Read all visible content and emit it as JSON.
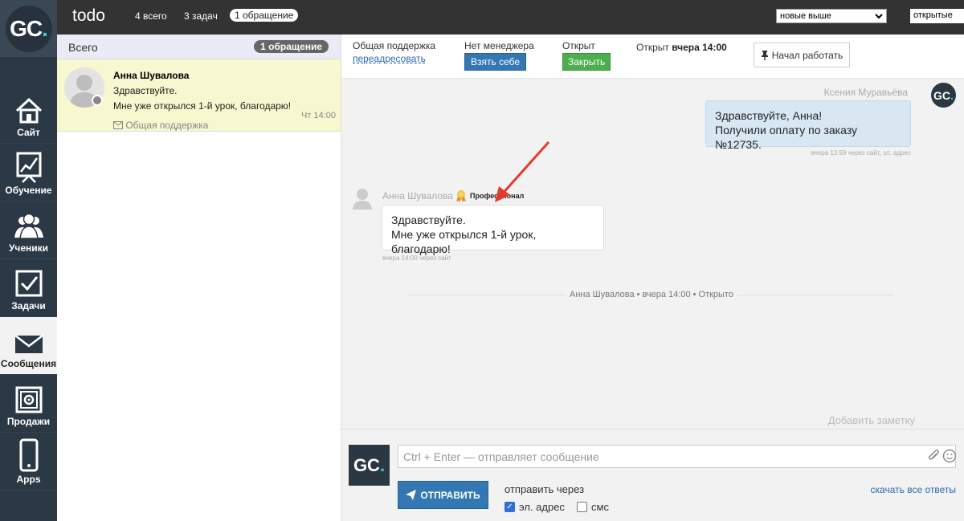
{
  "logo": {
    "text": "GC",
    "dot": "."
  },
  "nav": [
    {
      "label": "Сайт",
      "icon": "house-icon"
    },
    {
      "label": "Обучение",
      "icon": "chart-board-icon"
    },
    {
      "label": "Ученики",
      "icon": "people-icon"
    },
    {
      "label": "Задачи",
      "icon": "checkbox-icon"
    },
    {
      "label": "Сообщения",
      "icon": "envelope-icon"
    },
    {
      "label": "Продажи",
      "icon": "safe-icon"
    },
    {
      "label": "Apps",
      "icon": "phone-icon"
    }
  ],
  "topbar": {
    "title": "todo",
    "total": "4 всего",
    "tasks": "3 задач",
    "requests": "1 обращение",
    "sort": "новые выше",
    "filter": "открытые"
  },
  "list": {
    "header": "Всего",
    "badge": "1 обращение",
    "item": {
      "name": "Анна Шувалова",
      "line1": "Здравствуйте.",
      "line2": "Мне уже открылся 1-й урок, благодарю!",
      "source": "Общая поддержка",
      "time": "Чт 14:00"
    }
  },
  "header": {
    "dept_label": "Общая поддержка",
    "redirect": "переадресовать",
    "manager_label": "Нет менеджера",
    "take": "Взять себе",
    "status_label": "Открыт",
    "close": "Закрыть",
    "opened_prefix": "Открыт",
    "opened_time": "вчера 14:00",
    "start_work": "Начал работать"
  },
  "chat": {
    "operator_name": "Ксения Муравьёва",
    "operator_line1": "Здравствуйте, Анна!",
    "operator_line2": "Получили оплату по заказу №12735.",
    "operator_meta": "вчера 13:59 через сайт, эл. адрес",
    "client_name": "Анна Шувалова",
    "client_rank": "Профессионал",
    "client_line1": "Здравствуйте.",
    "client_line2": "Мне уже открылся 1-й урок, благодарю!",
    "client_meta": "вчера 14:00 через сайт",
    "divider": "Анна Шувалова • вчера 14:00 • Открыто",
    "add_note": "Добавить заметку"
  },
  "composer": {
    "placeholder": "Ctrl + Enter — отправляет сообщение",
    "send": "ОТПРАВИТЬ",
    "send_via": "отправить через",
    "email": "эл. адрес",
    "email_checked": true,
    "sms": "смс",
    "sms_checked": false,
    "download": "скачать все ответы"
  },
  "colors": {
    "nav_bg": "#2b3846",
    "accent_blue": "#3377b3",
    "close_green": "#4cae4c",
    "selected_row": "#f7f7d0",
    "arrow_red": "#e03b30"
  }
}
